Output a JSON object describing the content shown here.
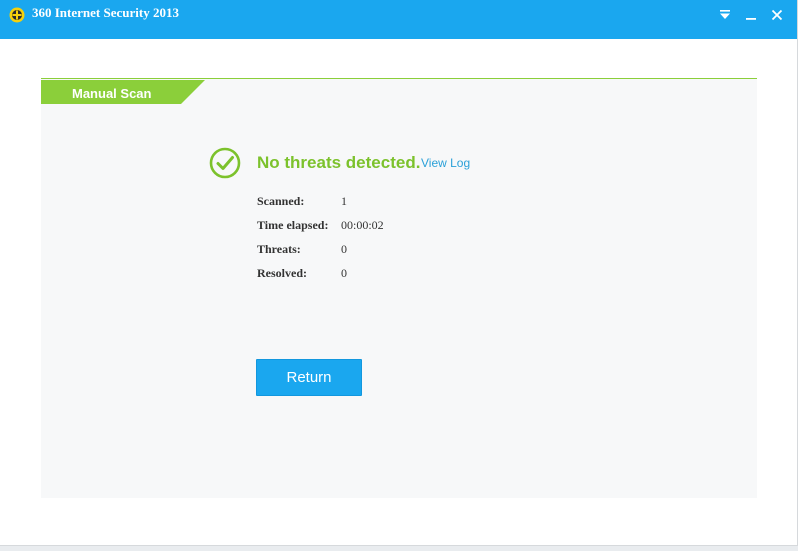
{
  "window": {
    "title": "360 Internet Security 2013",
    "icons": {
      "logo": "360-logo-icon",
      "menu": "menu-dropdown-icon",
      "minimize": "minimize-icon",
      "close": "close-icon"
    }
  },
  "scan": {
    "tab_label": "Manual Scan",
    "status_icon": "check-circle-icon",
    "result_text": "No threats detected.",
    "view_log_label": "View Log",
    "stats": [
      {
        "label": "Scanned:",
        "value": "1"
      },
      {
        "label": "Time elapsed:",
        "value": "00:00:02"
      },
      {
        "label": "Threats:",
        "value": "0"
      },
      {
        "label": "Resolved:",
        "value": "0"
      }
    ],
    "return_label": "Return"
  },
  "colors": {
    "titlebar": "#1aa7ef",
    "accent_green": "#7cc22c",
    "link": "#2aa0d8",
    "button": "#1aa7ef"
  }
}
